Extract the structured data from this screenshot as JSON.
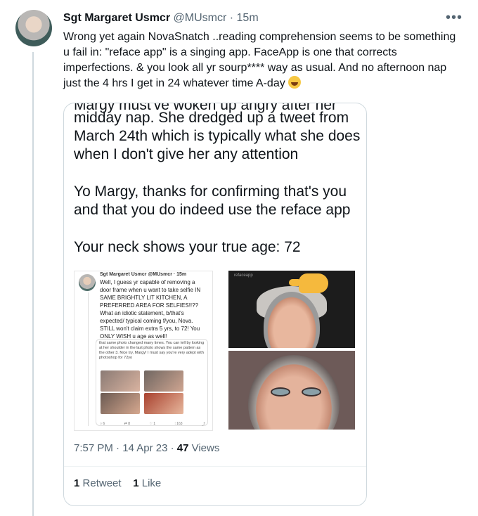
{
  "tweet": {
    "display_name": "Sgt Margaret Usmcr",
    "handle": "@MUsmcr",
    "separator": "·",
    "time": "15m",
    "more_icon": "more-horizontal-icon",
    "text": "Wrong yet again NovaSnatch ..reading comprehension seems to be something u fail in: \"reface app\" is a singing app. FaceApp is one that corrects imperfections. & you look all yr sourp**** way as usual. And no afternoon nap just the 4 hrs I get in 24 whatever time A-day",
    "emoji": "rolling-on-floor-laughing-emoji"
  },
  "quoted": {
    "cut_line": "Margy must've woken up angry after her",
    "paragraphs": [
      "midday nap. She dredged up a tweet from March 24th which is typically what she does when I don't give her any attention",
      "Yo Margy, thanks for confirming that's you and that you do indeed use the reface app",
      "Your neck shows your true age: 72"
    ],
    "screenshot": {
      "name": "Sgt Margaret Usmcr @MUsmcr · 15m",
      "text": "Well, I guess yr capable of removing a door frame when u want to take selfie IN SAME BRIGHTLY LIT KITCHEN, A PREFERRED AREA FOR SELFIES!!?? What an idiotic statement, b/that's expected/ typical coming f/you, Nova. STILL won't claim extra 5 yrs, to 72! You ONLY WISH u age as well!",
      "quote_text": "that same photo changed many times. You can tell by looking at her shoulder in the last photo shows the same pattern as the other 3. Nice try, Margy! I must say you're very adept with photoshop for 72yo",
      "actions": [
        "○ 6",
        "⇄ 8",
        "♡ 1",
        "⫶ 163",
        "⤴"
      ]
    },
    "photo_watermark": "refaceapp",
    "meta_time": "7:57 PM · 14 Apr 23 ·",
    "views_count": "47",
    "views_label": "Views",
    "retweet_count": "1",
    "retweet_label": "Retweet",
    "like_count": "1",
    "like_label": "Like"
  }
}
